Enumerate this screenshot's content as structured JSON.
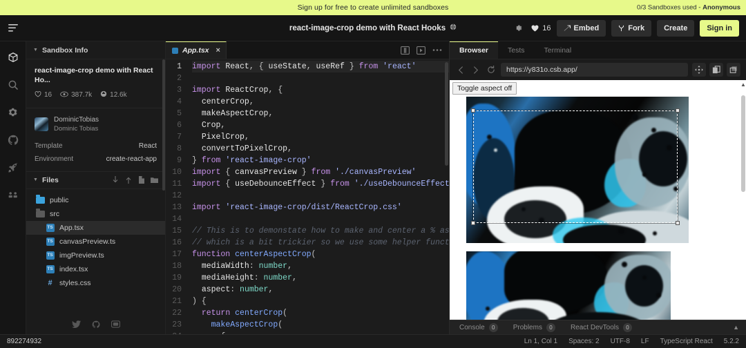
{
  "promo": {
    "text": "Sign up for free to create unlimited sandboxes",
    "usage_prefix": "0/3 Sandboxes used -",
    "usage_user": "Anonymous"
  },
  "header": {
    "title": "react-image-crop demo with React Hooks",
    "likes": "16",
    "buttons": {
      "embed": "Embed",
      "fork": "Fork",
      "create": "Create",
      "signin": "Sign in"
    }
  },
  "rail": {
    "items": [
      {
        "name": "explorer-icon",
        "label": "Explorer"
      },
      {
        "name": "search-icon",
        "label": "Search"
      },
      {
        "name": "settings-icon",
        "label": "Settings"
      },
      {
        "name": "github-icon",
        "label": "GitHub"
      },
      {
        "name": "deploy-icon",
        "label": "Deploy"
      },
      {
        "name": "collaborators-icon",
        "label": "Live"
      }
    ]
  },
  "sidebar": {
    "info_header": "Sandbox Info",
    "sandbox_title": "react-image-crop demo with React Ho...",
    "stats": {
      "likes": "16",
      "views": "387.7k",
      "forks": "12.6k"
    },
    "author": {
      "handle": "DominicTobias",
      "fullname": "Dominic Tobias"
    },
    "meta": [
      {
        "key": "Template",
        "value": "React"
      },
      {
        "key": "Environment",
        "value": "create-react-app"
      }
    ],
    "files_header": "Files",
    "files": [
      {
        "label": "public",
        "type": "folder",
        "indent": false,
        "selected": false
      },
      {
        "label": "src",
        "type": "folder-open",
        "indent": false,
        "selected": false
      },
      {
        "label": "App.tsx",
        "type": "tsx",
        "indent": true,
        "selected": true
      },
      {
        "label": "canvasPreview.ts",
        "type": "ts",
        "indent": true,
        "selected": false
      },
      {
        "label": "imgPreview.ts",
        "type": "ts",
        "indent": true,
        "selected": false
      },
      {
        "label": "index.tsx",
        "type": "tsx",
        "indent": true,
        "selected": false
      },
      {
        "label": "styles.css",
        "type": "css",
        "indent": true,
        "selected": false
      }
    ],
    "social": [
      "twitter-icon",
      "github-icon",
      "discord-icon"
    ]
  },
  "editor": {
    "tab_label": "App.tsx",
    "tab_close": "×",
    "lines": [
      {
        "n": "1",
        "current": true,
        "html": "<span class=\"kw\">import</span> <span class=\"id\">React</span><span class=\"pun\">, {</span> <span class=\"id\">useState</span><span class=\"pun\">,</span> <span class=\"id\">useRef</span> <span class=\"pun\">}</span> <span class=\"kw\">from</span> <span class=\"str\">'react'</span>"
      },
      {
        "n": "2",
        "current": false,
        "html": ""
      },
      {
        "n": "3",
        "current": false,
        "html": "<span class=\"kw\">import</span> <span class=\"id\">ReactCrop</span><span class=\"pun\">, {</span>"
      },
      {
        "n": "4",
        "current": false,
        "html": "  <span class=\"id\">centerCrop</span><span class=\"pun\">,</span>"
      },
      {
        "n": "5",
        "current": false,
        "html": "  <span class=\"id\">makeAspectCrop</span><span class=\"pun\">,</span>"
      },
      {
        "n": "6",
        "current": false,
        "html": "  <span class=\"id\">Crop</span><span class=\"pun\">,</span>"
      },
      {
        "n": "7",
        "current": false,
        "html": "  <span class=\"id\">PixelCrop</span><span class=\"pun\">,</span>"
      },
      {
        "n": "8",
        "current": false,
        "html": "  <span class=\"id\">convertToPixelCrop</span><span class=\"pun\">,</span>"
      },
      {
        "n": "9",
        "current": false,
        "html": "<span class=\"pun\">}</span> <span class=\"kw\">from</span> <span class=\"str\">'react-image-crop'</span>"
      },
      {
        "n": "10",
        "current": false,
        "html": "<span class=\"kw\">import</span> <span class=\"pun\">{</span> <span class=\"id\">canvasPreview</span> <span class=\"pun\">}</span> <span class=\"kw\">from</span> <span class=\"str\">'./canvasPreview'</span>"
      },
      {
        "n": "11",
        "current": false,
        "html": "<span class=\"kw\">import</span> <span class=\"pun\">{</span> <span class=\"id\">useDebounceEffect</span> <span class=\"pun\">}</span> <span class=\"kw\">from</span> <span class=\"str\">'./useDebounceEffect'</span>"
      },
      {
        "n": "12",
        "current": false,
        "html": ""
      },
      {
        "n": "13",
        "current": false,
        "html": "<span class=\"kw\">import</span> <span class=\"str\">'react-image-crop/dist/ReactCrop.css'</span>"
      },
      {
        "n": "14",
        "current": false,
        "html": ""
      },
      {
        "n": "15",
        "current": false,
        "html": "<span class=\"cmt\">// This is to demonstate how to make and center a % asp</span>"
      },
      {
        "n": "16",
        "current": false,
        "html": "<span class=\"cmt\">// which is a bit trickier so we use some helper functi</span>"
      },
      {
        "n": "17",
        "current": false,
        "html": "<span class=\"kw\">function</span> <span class=\"fn\">centerAspectCrop</span><span class=\"pun\">(</span>"
      },
      {
        "n": "18",
        "current": false,
        "html": "  <span class=\"id\">mediaWidth</span><span class=\"pun\">:</span> <span class=\"grn\">number</span><span class=\"pun\">,</span>"
      },
      {
        "n": "19",
        "current": false,
        "html": "  <span class=\"id\">mediaHeight</span><span class=\"pun\">:</span> <span class=\"grn\">number</span><span class=\"pun\">,</span>"
      },
      {
        "n": "20",
        "current": false,
        "html": "  <span class=\"id\">aspect</span><span class=\"pun\">:</span> <span class=\"grn\">number</span><span class=\"pun\">,</span>"
      },
      {
        "n": "21",
        "current": false,
        "html": "<span class=\"pun\">) {</span>"
      },
      {
        "n": "22",
        "current": false,
        "html": "  <span class=\"kw\">return</span> <span class=\"fn\">centerCrop</span><span class=\"pun\">(</span>"
      },
      {
        "n": "23",
        "current": false,
        "html": "    <span class=\"fn\">makeAspectCrop</span><span class=\"pun\">(</span>"
      },
      {
        "n": "24",
        "current": false,
        "html": "      <span class=\"pun\">{</span>"
      }
    ]
  },
  "preview": {
    "tabs": [
      {
        "label": "Browser",
        "active": true
      },
      {
        "label": "Tests",
        "active": false
      },
      {
        "label": "Terminal",
        "active": false
      }
    ],
    "url": "https://y831o.csb.app/",
    "tooltip": "Toggle aspect off",
    "devtools": [
      {
        "label": "Console",
        "badge": "0"
      },
      {
        "label": "Problems",
        "badge": "0"
      },
      {
        "label": "React DevTools",
        "badge": "0"
      }
    ]
  },
  "statusbar": {
    "sandbox_id": "892274932",
    "items": [
      "Ln 1, Col 1",
      "Spaces: 2",
      "UTF-8",
      "LF",
      "TypeScript React",
      "5.2.2"
    ]
  }
}
